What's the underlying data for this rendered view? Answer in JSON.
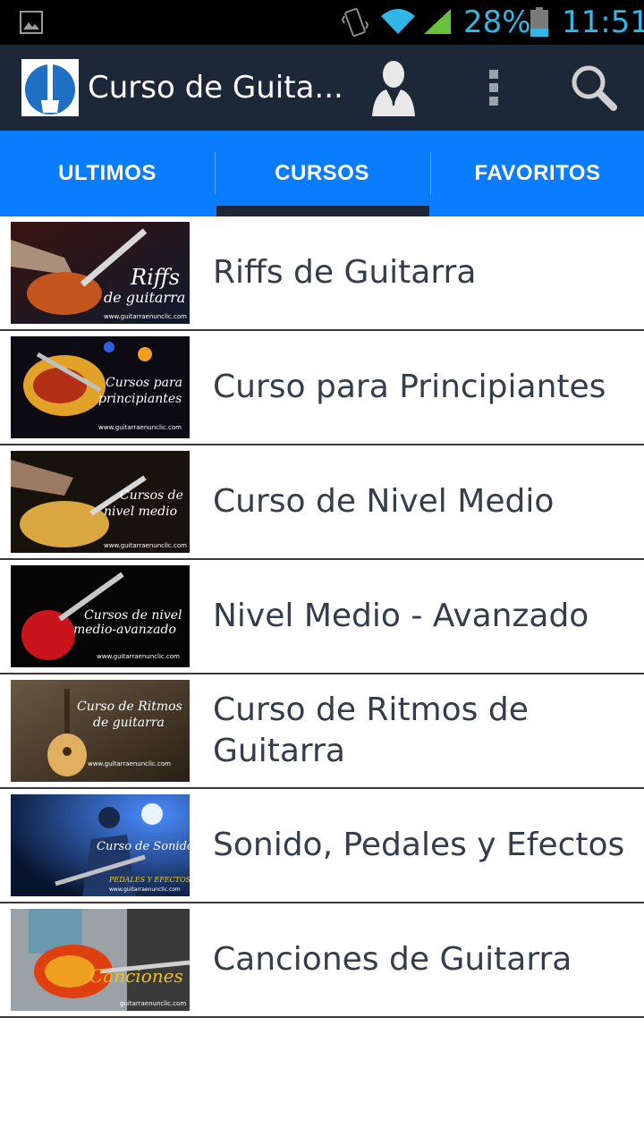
{
  "status_bar": {
    "battery_percent": "28%",
    "time": "11:51",
    "icons": [
      "gallery-icon",
      "vibrate-icon",
      "wifi-icon",
      "signal-icon",
      "battery-icon"
    ],
    "accent_color": "#33b5e5"
  },
  "action_bar": {
    "title": "Curso de Guita...",
    "icons": [
      "app-logo-icon",
      "account-icon",
      "overflow-menu-icon",
      "search-icon"
    ],
    "background": "#1c2838"
  },
  "tabs": {
    "items": [
      {
        "label": "ULTIMOS"
      },
      {
        "label": "CURSOS"
      },
      {
        "label": "FAVORITOS"
      }
    ],
    "selected": "CURSOS",
    "background": "#0a7dff"
  },
  "courses": [
    {
      "title": "Riffs de Guitarra",
      "thumb": {
        "line1": "Riffs",
        "line2": "de guitarra",
        "url": "www.guitarraenunclic.com"
      }
    },
    {
      "title": "Curso para Principiantes",
      "thumb": {
        "line1": "Cursos para",
        "line2": "principiantes",
        "url": "www.guitarraenunclic.com"
      }
    },
    {
      "title": "Curso de Nivel Medio",
      "thumb": {
        "line1": "Cursos de",
        "line2": "nivel medio",
        "url": "www.guitarraenunclic.com"
      }
    },
    {
      "title": "Nivel Medio - Avanzado",
      "thumb": {
        "line1": "Cursos de nivel",
        "line2": "medio-avanzado",
        "url": "www.guitarraenunclic.com"
      }
    },
    {
      "title": "Curso de Ritmos de Guitarra",
      "thumb": {
        "line1": "Curso de Ritmos",
        "line2": "de guitarra",
        "url": "www.guitarraenunclic.com"
      }
    },
    {
      "title": "Sonido, Pedales y Efectos",
      "thumb": {
        "line1": "Curso de Sonido",
        "line2": "PEDALES Y EFECTOS",
        "url": "www.guitarraenunclic.com"
      }
    },
    {
      "title": "Canciones de Guitarra",
      "thumb": {
        "line1": "Canciones",
        "line2": "",
        "url": "guitarraenunclic.com"
      }
    }
  ]
}
